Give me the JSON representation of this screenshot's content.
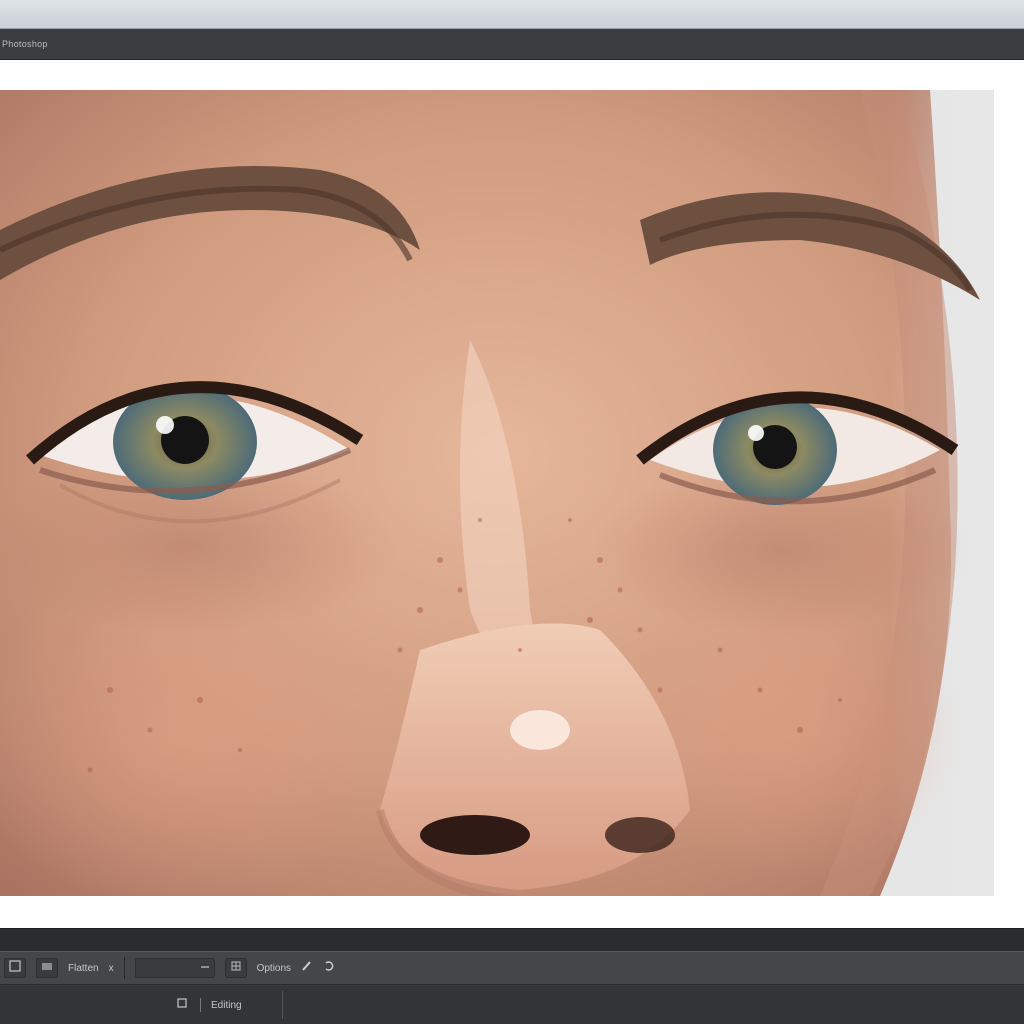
{
  "app": {
    "title": "Photoshop"
  },
  "options_bar": {
    "item1_label": "Flatten",
    "item2_label": "x",
    "item3_label": "Options"
  },
  "status_bar": {
    "label": "Editing"
  },
  "icons": {
    "tool_preset": "tool-preset-icon",
    "layer": "layer-icon",
    "arrow": "arrow-icon",
    "grid": "grid-icon",
    "brush": "brush-icon",
    "swap": "swap-icon",
    "document": "document-icon"
  },
  "colors": {
    "ui_dark": "#3c3d3f",
    "canvas_bg": "#ffffff"
  }
}
